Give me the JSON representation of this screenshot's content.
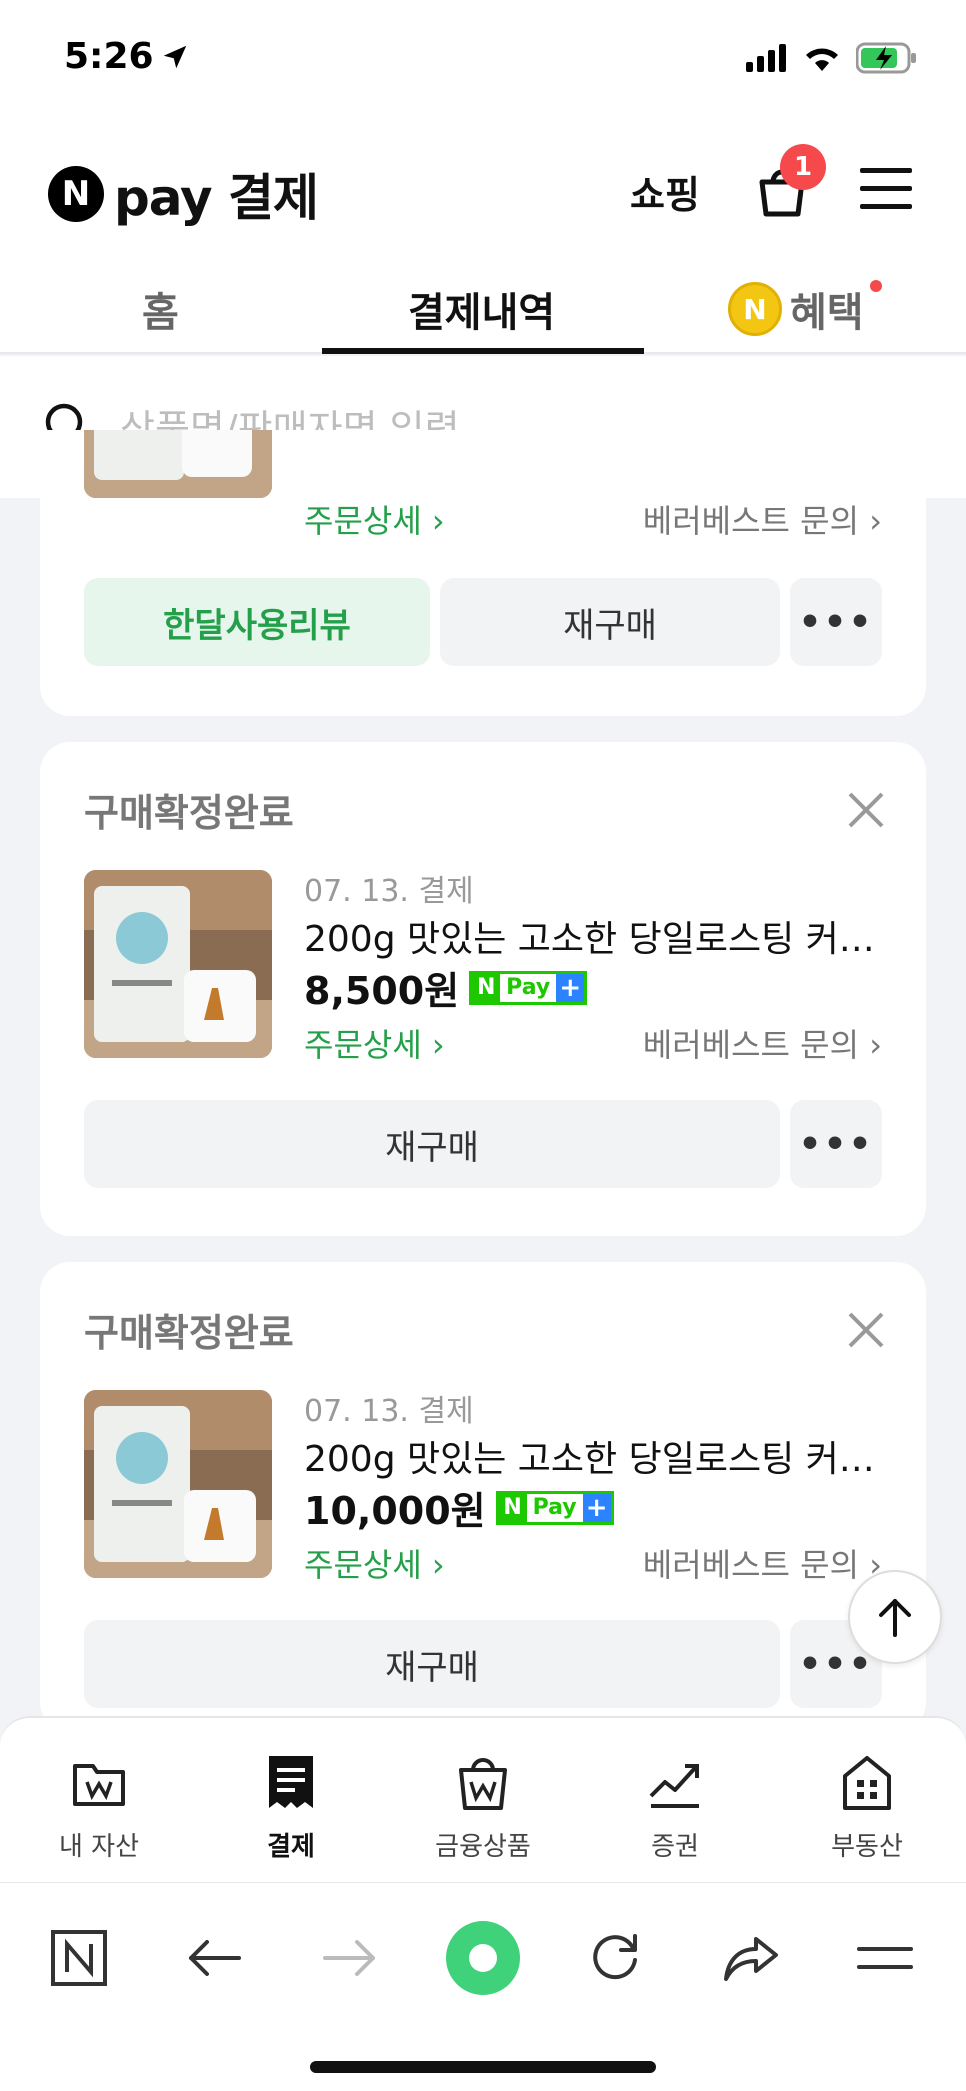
{
  "status": {
    "time": "5:26"
  },
  "header": {
    "logo_n": "N",
    "logo_text": "pay 결제",
    "shopping_label": "쇼핑",
    "cart_badge": "1"
  },
  "tabs": [
    {
      "label": "홈"
    },
    {
      "label": "결제내역"
    },
    {
      "label": "혜택"
    }
  ],
  "benefit_coin": "N",
  "search": {
    "placeholder": "상품명/판매자명 입력"
  },
  "partial_card": {
    "order_link": "주문상세 ›",
    "seller_link": "베러베스트 문의 ›",
    "review_button": "한달사용리뷰",
    "rebuy_button": "재구매",
    "more_button": "•••"
  },
  "orders": [
    {
      "status": "구매확정완료",
      "date": "07. 13. 결제",
      "name": "200g 맛있는 고소한 당일로스팅 커피 ...",
      "price": "8,500원",
      "order_link": "주문상세 ›",
      "seller_link": "베러베스트 문의 ›",
      "rebuy_button": "재구매",
      "more_button": "•••"
    },
    {
      "status": "구매확정완료",
      "date": "07. 13. 결제",
      "name": "200g 맛있는 고소한 당일로스팅 커피 ...",
      "price": "10,000원",
      "order_link": "주문상세 ›",
      "seller_link": "베러베스트 문의 ›",
      "rebuy_button": "재구매",
      "more_button": "•••"
    }
  ],
  "npay_badge": {
    "n": "N",
    "text": "Pay",
    "plus": "+"
  },
  "bottom_nav": [
    {
      "label": "내 자산",
      "icon": "wallet-icon"
    },
    {
      "label": "결제",
      "icon": "receipt-icon"
    },
    {
      "label": "금융상품",
      "icon": "shopping-bag-won-icon"
    },
    {
      "label": "증권",
      "icon": "chart-up-icon"
    },
    {
      "label": "부동산",
      "icon": "building-icon"
    }
  ],
  "browser_n": "N",
  "colors": {
    "accent_green": "#25a04a",
    "npay_green": "#1ec800",
    "badge_red": "#f5494c"
  }
}
